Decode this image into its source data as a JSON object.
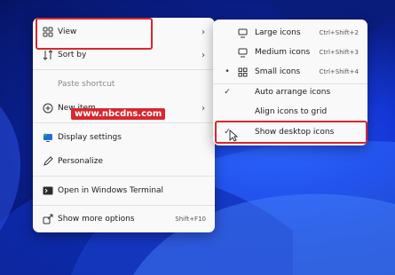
{
  "main_menu": {
    "items": [
      {
        "label": "View",
        "icon": "grid-icon"
      },
      {
        "label": "Sort by",
        "icon": "sort-icon"
      },
      {
        "label": "Paste shortcut",
        "icon": ""
      },
      {
        "label": "New item",
        "icon": "add-circle-icon"
      },
      {
        "label": "Display settings",
        "icon": "display-icon"
      },
      {
        "label": "Personalize",
        "icon": "pen-icon"
      },
      {
        "label": "Open in Windows Terminal",
        "icon": "terminal-icon"
      },
      {
        "label": "Show more options",
        "icon": "share-icon",
        "shortcut": "Shift+F10"
      }
    ]
  },
  "view_submenu": {
    "items": [
      {
        "label": "Large icons",
        "shortcut": "Ctrl+Shift+2",
        "icon": "monitor-icon"
      },
      {
        "label": "Medium icons",
        "shortcut": "Ctrl+Shift+3",
        "icon": "monitor-icon"
      },
      {
        "label": "Small icons",
        "shortcut": "Ctrl+Shift+4",
        "icon": "grid-small-icon",
        "selected": true
      },
      {
        "label": "Auto arrange icons",
        "checked": true
      },
      {
        "label": "Align icons to grid",
        "checked": false
      },
      {
        "label": "Show desktop icons",
        "checked": true
      }
    ]
  },
  "watermark": "www.nbcdns.com",
  "colors": {
    "highlight_box": "#d8272f",
    "menu_bg": "#f9f9f9"
  }
}
